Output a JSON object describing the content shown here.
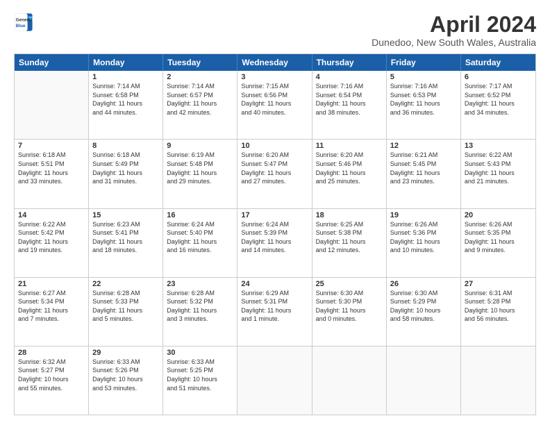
{
  "header": {
    "logo_general": "General",
    "logo_blue": "Blue",
    "title": "April 2024",
    "location": "Dunedoo, New South Wales, Australia"
  },
  "days_of_week": [
    "Sunday",
    "Monday",
    "Tuesday",
    "Wednesday",
    "Thursday",
    "Friday",
    "Saturday"
  ],
  "rows": [
    [
      {
        "day": "",
        "empty": true
      },
      {
        "day": "1",
        "line1": "Sunrise: 7:14 AM",
        "line2": "Sunset: 6:58 PM",
        "line3": "Daylight: 11 hours",
        "line4": "and 44 minutes."
      },
      {
        "day": "2",
        "line1": "Sunrise: 7:14 AM",
        "line2": "Sunset: 6:57 PM",
        "line3": "Daylight: 11 hours",
        "line4": "and 42 minutes."
      },
      {
        "day": "3",
        "line1": "Sunrise: 7:15 AM",
        "line2": "Sunset: 6:56 PM",
        "line3": "Daylight: 11 hours",
        "line4": "and 40 minutes."
      },
      {
        "day": "4",
        "line1": "Sunrise: 7:16 AM",
        "line2": "Sunset: 6:54 PM",
        "line3": "Daylight: 11 hours",
        "line4": "and 38 minutes."
      },
      {
        "day": "5",
        "line1": "Sunrise: 7:16 AM",
        "line2": "Sunset: 6:53 PM",
        "line3": "Daylight: 11 hours",
        "line4": "and 36 minutes."
      },
      {
        "day": "6",
        "line1": "Sunrise: 7:17 AM",
        "line2": "Sunset: 6:52 PM",
        "line3": "Daylight: 11 hours",
        "line4": "and 34 minutes."
      }
    ],
    [
      {
        "day": "7",
        "line1": "Sunrise: 6:18 AM",
        "line2": "Sunset: 5:51 PM",
        "line3": "Daylight: 11 hours",
        "line4": "and 33 minutes."
      },
      {
        "day": "8",
        "line1": "Sunrise: 6:18 AM",
        "line2": "Sunset: 5:49 PM",
        "line3": "Daylight: 11 hours",
        "line4": "and 31 minutes."
      },
      {
        "day": "9",
        "line1": "Sunrise: 6:19 AM",
        "line2": "Sunset: 5:48 PM",
        "line3": "Daylight: 11 hours",
        "line4": "and 29 minutes."
      },
      {
        "day": "10",
        "line1": "Sunrise: 6:20 AM",
        "line2": "Sunset: 5:47 PM",
        "line3": "Daylight: 11 hours",
        "line4": "and 27 minutes."
      },
      {
        "day": "11",
        "line1": "Sunrise: 6:20 AM",
        "line2": "Sunset: 5:46 PM",
        "line3": "Daylight: 11 hours",
        "line4": "and 25 minutes."
      },
      {
        "day": "12",
        "line1": "Sunrise: 6:21 AM",
        "line2": "Sunset: 5:45 PM",
        "line3": "Daylight: 11 hours",
        "line4": "and 23 minutes."
      },
      {
        "day": "13",
        "line1": "Sunrise: 6:22 AM",
        "line2": "Sunset: 5:43 PM",
        "line3": "Daylight: 11 hours",
        "line4": "and 21 minutes."
      }
    ],
    [
      {
        "day": "14",
        "line1": "Sunrise: 6:22 AM",
        "line2": "Sunset: 5:42 PM",
        "line3": "Daylight: 11 hours",
        "line4": "and 19 minutes."
      },
      {
        "day": "15",
        "line1": "Sunrise: 6:23 AM",
        "line2": "Sunset: 5:41 PM",
        "line3": "Daylight: 11 hours",
        "line4": "and 18 minutes."
      },
      {
        "day": "16",
        "line1": "Sunrise: 6:24 AM",
        "line2": "Sunset: 5:40 PM",
        "line3": "Daylight: 11 hours",
        "line4": "and 16 minutes."
      },
      {
        "day": "17",
        "line1": "Sunrise: 6:24 AM",
        "line2": "Sunset: 5:39 PM",
        "line3": "Daylight: 11 hours",
        "line4": "and 14 minutes."
      },
      {
        "day": "18",
        "line1": "Sunrise: 6:25 AM",
        "line2": "Sunset: 5:38 PM",
        "line3": "Daylight: 11 hours",
        "line4": "and 12 minutes."
      },
      {
        "day": "19",
        "line1": "Sunrise: 6:26 AM",
        "line2": "Sunset: 5:36 PM",
        "line3": "Daylight: 11 hours",
        "line4": "and 10 minutes."
      },
      {
        "day": "20",
        "line1": "Sunrise: 6:26 AM",
        "line2": "Sunset: 5:35 PM",
        "line3": "Daylight: 11 hours",
        "line4": "and 9 minutes."
      }
    ],
    [
      {
        "day": "21",
        "line1": "Sunrise: 6:27 AM",
        "line2": "Sunset: 5:34 PM",
        "line3": "Daylight: 11 hours",
        "line4": "and 7 minutes."
      },
      {
        "day": "22",
        "line1": "Sunrise: 6:28 AM",
        "line2": "Sunset: 5:33 PM",
        "line3": "Daylight: 11 hours",
        "line4": "and 5 minutes."
      },
      {
        "day": "23",
        "line1": "Sunrise: 6:28 AM",
        "line2": "Sunset: 5:32 PM",
        "line3": "Daylight: 11 hours",
        "line4": "and 3 minutes."
      },
      {
        "day": "24",
        "line1": "Sunrise: 6:29 AM",
        "line2": "Sunset: 5:31 PM",
        "line3": "Daylight: 11 hours",
        "line4": "and 1 minute."
      },
      {
        "day": "25",
        "line1": "Sunrise: 6:30 AM",
        "line2": "Sunset: 5:30 PM",
        "line3": "Daylight: 11 hours",
        "line4": "and 0 minutes."
      },
      {
        "day": "26",
        "line1": "Sunrise: 6:30 AM",
        "line2": "Sunset: 5:29 PM",
        "line3": "Daylight: 10 hours",
        "line4": "and 58 minutes."
      },
      {
        "day": "27",
        "line1": "Sunrise: 6:31 AM",
        "line2": "Sunset: 5:28 PM",
        "line3": "Daylight: 10 hours",
        "line4": "and 56 minutes."
      }
    ],
    [
      {
        "day": "28",
        "line1": "Sunrise: 6:32 AM",
        "line2": "Sunset: 5:27 PM",
        "line3": "Daylight: 10 hours",
        "line4": "and 55 minutes."
      },
      {
        "day": "29",
        "line1": "Sunrise: 6:33 AM",
        "line2": "Sunset: 5:26 PM",
        "line3": "Daylight: 10 hours",
        "line4": "and 53 minutes."
      },
      {
        "day": "30",
        "line1": "Sunrise: 6:33 AM",
        "line2": "Sunset: 5:25 PM",
        "line3": "Daylight: 10 hours",
        "line4": "and 51 minutes."
      },
      {
        "day": "",
        "empty": true
      },
      {
        "day": "",
        "empty": true
      },
      {
        "day": "",
        "empty": true
      },
      {
        "day": "",
        "empty": true
      }
    ]
  ]
}
